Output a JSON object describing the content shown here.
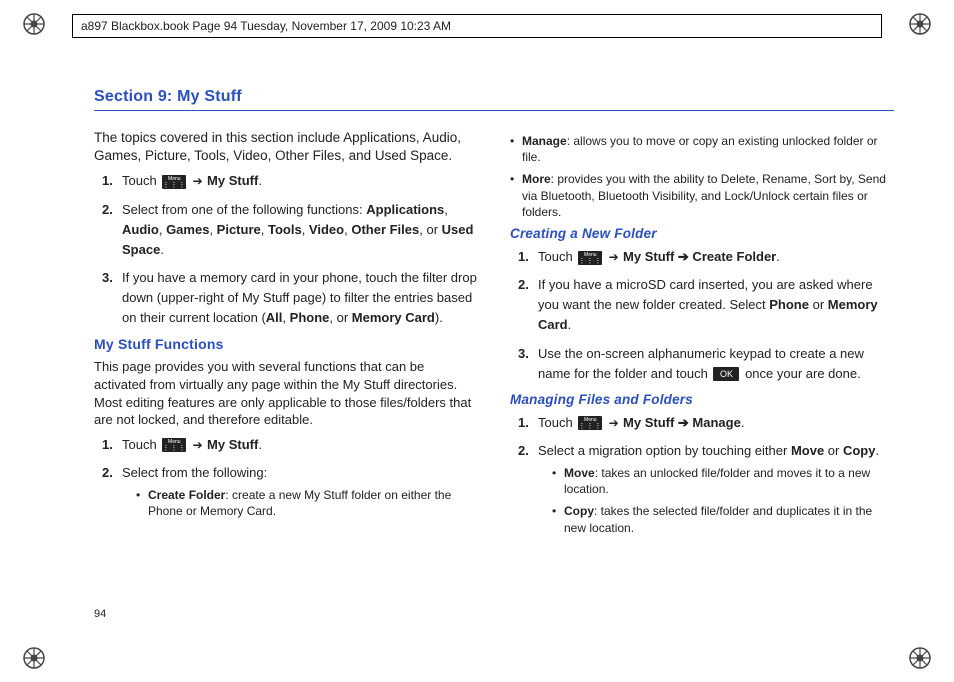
{
  "header": "a897 Blackbox.book  Page 94  Tuesday, November 17, 2009  10:23 AM",
  "page_number": "94",
  "section_title": "Section 9: My Stuff",
  "intro": "The topics covered in this section include Applications, Audio, Games, Picture, Tools, Video, Other Files, and Used Space.",
  "steps1": {
    "s1_a": "Touch ",
    "s1_b": " ➔ ",
    "s1_c": "My Stuff",
    "s1_d": ".",
    "s2_a": "Select from one of the following functions: ",
    "s2_apps": "Applications",
    "s2_sep": ", ",
    "s2_audio": "Audio",
    "s2_games": "Games",
    "s2_picture": "Picture",
    "s2_tools": "Tools",
    "s2_video": "Video",
    "s2_other": "Other Files",
    "s2_or": ", or ",
    "s2_used": "Used Space",
    "s2_end": ".",
    "s3_a": "If you have a memory card in your phone, touch the filter drop down (upper-right of My Stuff page) to filter the entries based on their current location (",
    "s3_all": "All",
    "s3_phone": "Phone",
    "s3_or": ", or ",
    "s3_mc": "Memory Card",
    "s3_end": ")."
  },
  "mystuff_heading": "My Stuff Functions",
  "mystuff_intro": "This page provides you with several functions that can be activated from virtually any page within the My Stuff directories. Most editing features are only applicable to those files/folders that are not locked, and therefore editable.",
  "steps2": {
    "s1_a": "Touch ",
    "s1_b": " ➔ ",
    "s1_c": "My Stuff",
    "s1_d": ".",
    "s2_a": "Select from the following:",
    "b1_lead": "Create Folder",
    "b1_rest": ": create a new My Stuff folder on either the Phone or Memory Card.",
    "b2_lead": "Manage",
    "b2_rest": ": allows you to move or copy an existing unlocked folder or file.",
    "b3_lead": "More",
    "b3_rest": ": provides you with the ability to Delete, Rename, Sort by, Send via Bluetooth, Bluetooth Visibility, and Lock/Unlock certain files or folders."
  },
  "create_heading": "Creating a New Folder",
  "create_steps": {
    "s1_a": "Touch ",
    "s1_b": " ➔ ",
    "s1_c": "My Stuff ➔ Create Folder",
    "s1_d": ".",
    "s2_a": "If you have a microSD card inserted, you are asked where you want the new folder created. Select ",
    "s2_phone": "Phone",
    "s2_or": " or ",
    "s2_card": "Memory Card",
    "s2_end": ".",
    "s3_a": "Use the on-screen alphanumeric keypad to create a new name for the folder and touch ",
    "s3_b": " once your are done."
  },
  "manage_heading": "Managing Files and Folders",
  "manage_steps": {
    "s1_a": "Touch ",
    "s1_b": " ➔ ",
    "s1_c": "My Stuff ➔ Manage",
    "s1_d": ".",
    "s2_a": "Select a migration option by touching either ",
    "s2_move": "Move",
    "s2_or": " or ",
    "s2_copy": "Copy",
    "s2_end": ".",
    "b1_lead": "Move",
    "b1_rest": ": takes an unlocked file/folder and moves it to a new location.",
    "b2_lead": "Copy",
    "b2_rest": ": takes the selected file/folder and duplicates it in the new location."
  },
  "icons": {
    "menu_label": "Menu",
    "ok_label": "OK"
  }
}
